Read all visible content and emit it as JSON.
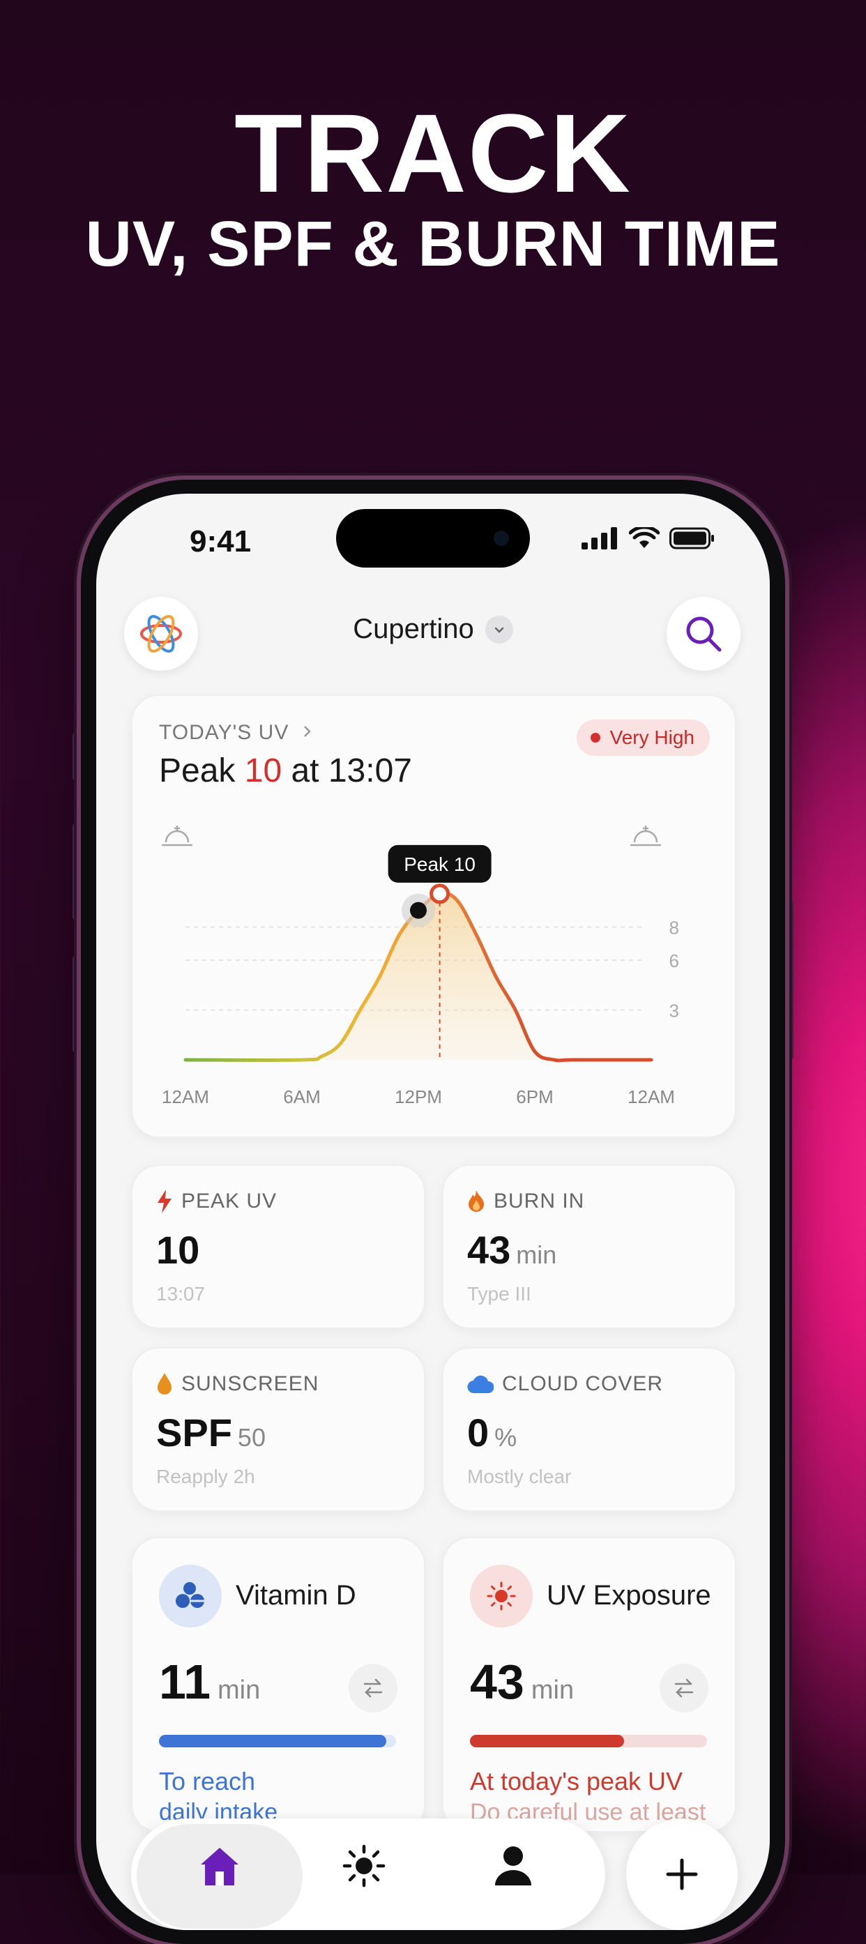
{
  "headline": {
    "line1": "TRACK",
    "line2": "UV, SPF & BURN TIME"
  },
  "status_bar": {
    "time": "9:41"
  },
  "header": {
    "location": "Cupertino"
  },
  "uv_card": {
    "label": "TODAY'S UV",
    "peak_prefix": "Peak ",
    "peak_value": "10",
    "peak_suffix": " at 13:07",
    "badge": "Very High",
    "tooltip": "Peak 10"
  },
  "chart_data": {
    "type": "line",
    "x_ticks": [
      "12AM",
      "6AM",
      "12PM",
      "6PM",
      "12AM"
    ],
    "y_ticks": [
      "8",
      "6",
      "3"
    ],
    "series": [
      {
        "x": [
          0,
          6,
          7,
          8,
          9,
          10,
          11,
          12,
          13.1,
          14,
          15,
          16,
          17,
          18,
          19,
          20,
          24
        ],
        "y": [
          0,
          0,
          0.2,
          1,
          3,
          5,
          7.5,
          9,
          10,
          9.6,
          7.5,
          5,
          3,
          0.5,
          0,
          0,
          0
        ]
      }
    ],
    "current_time": 12,
    "peak": {
      "x": 13.1,
      "y": 10
    },
    "ylim": [
      0,
      11
    ],
    "xlim": [
      0,
      24
    ],
    "colors": {
      "low": "#7cb342",
      "mid": "#f2b230",
      "high": "#d84c2a"
    }
  },
  "stats": {
    "peak_uv": {
      "title": "PEAK UV",
      "value": "10",
      "sub": "13:07"
    },
    "burn_in": {
      "title": "BURN IN",
      "value": "43",
      "unit": "min",
      "sub": "Type III"
    },
    "sunscreen": {
      "title": "SUNSCREEN",
      "value": "SPF",
      "unit": "50",
      "sub": "Reapply 2h"
    },
    "cloud_cover": {
      "title": "CLOUD COVER",
      "value": "0",
      "unit": "%",
      "sub": "Mostly clear"
    }
  },
  "vitamin_d": {
    "title": "Vitamin D",
    "value": "11",
    "unit": "min",
    "progress": 0.96,
    "note": "To reach",
    "note2": "daily intake"
  },
  "uv_exposure": {
    "title": "UV Exposure",
    "value": "43",
    "unit": "min",
    "progress": 0.65,
    "note": "At today's peak UV",
    "note2": "Do careful use at least"
  },
  "tabs": [
    {
      "name": "home"
    },
    {
      "name": "uv"
    },
    {
      "name": "profile"
    }
  ]
}
